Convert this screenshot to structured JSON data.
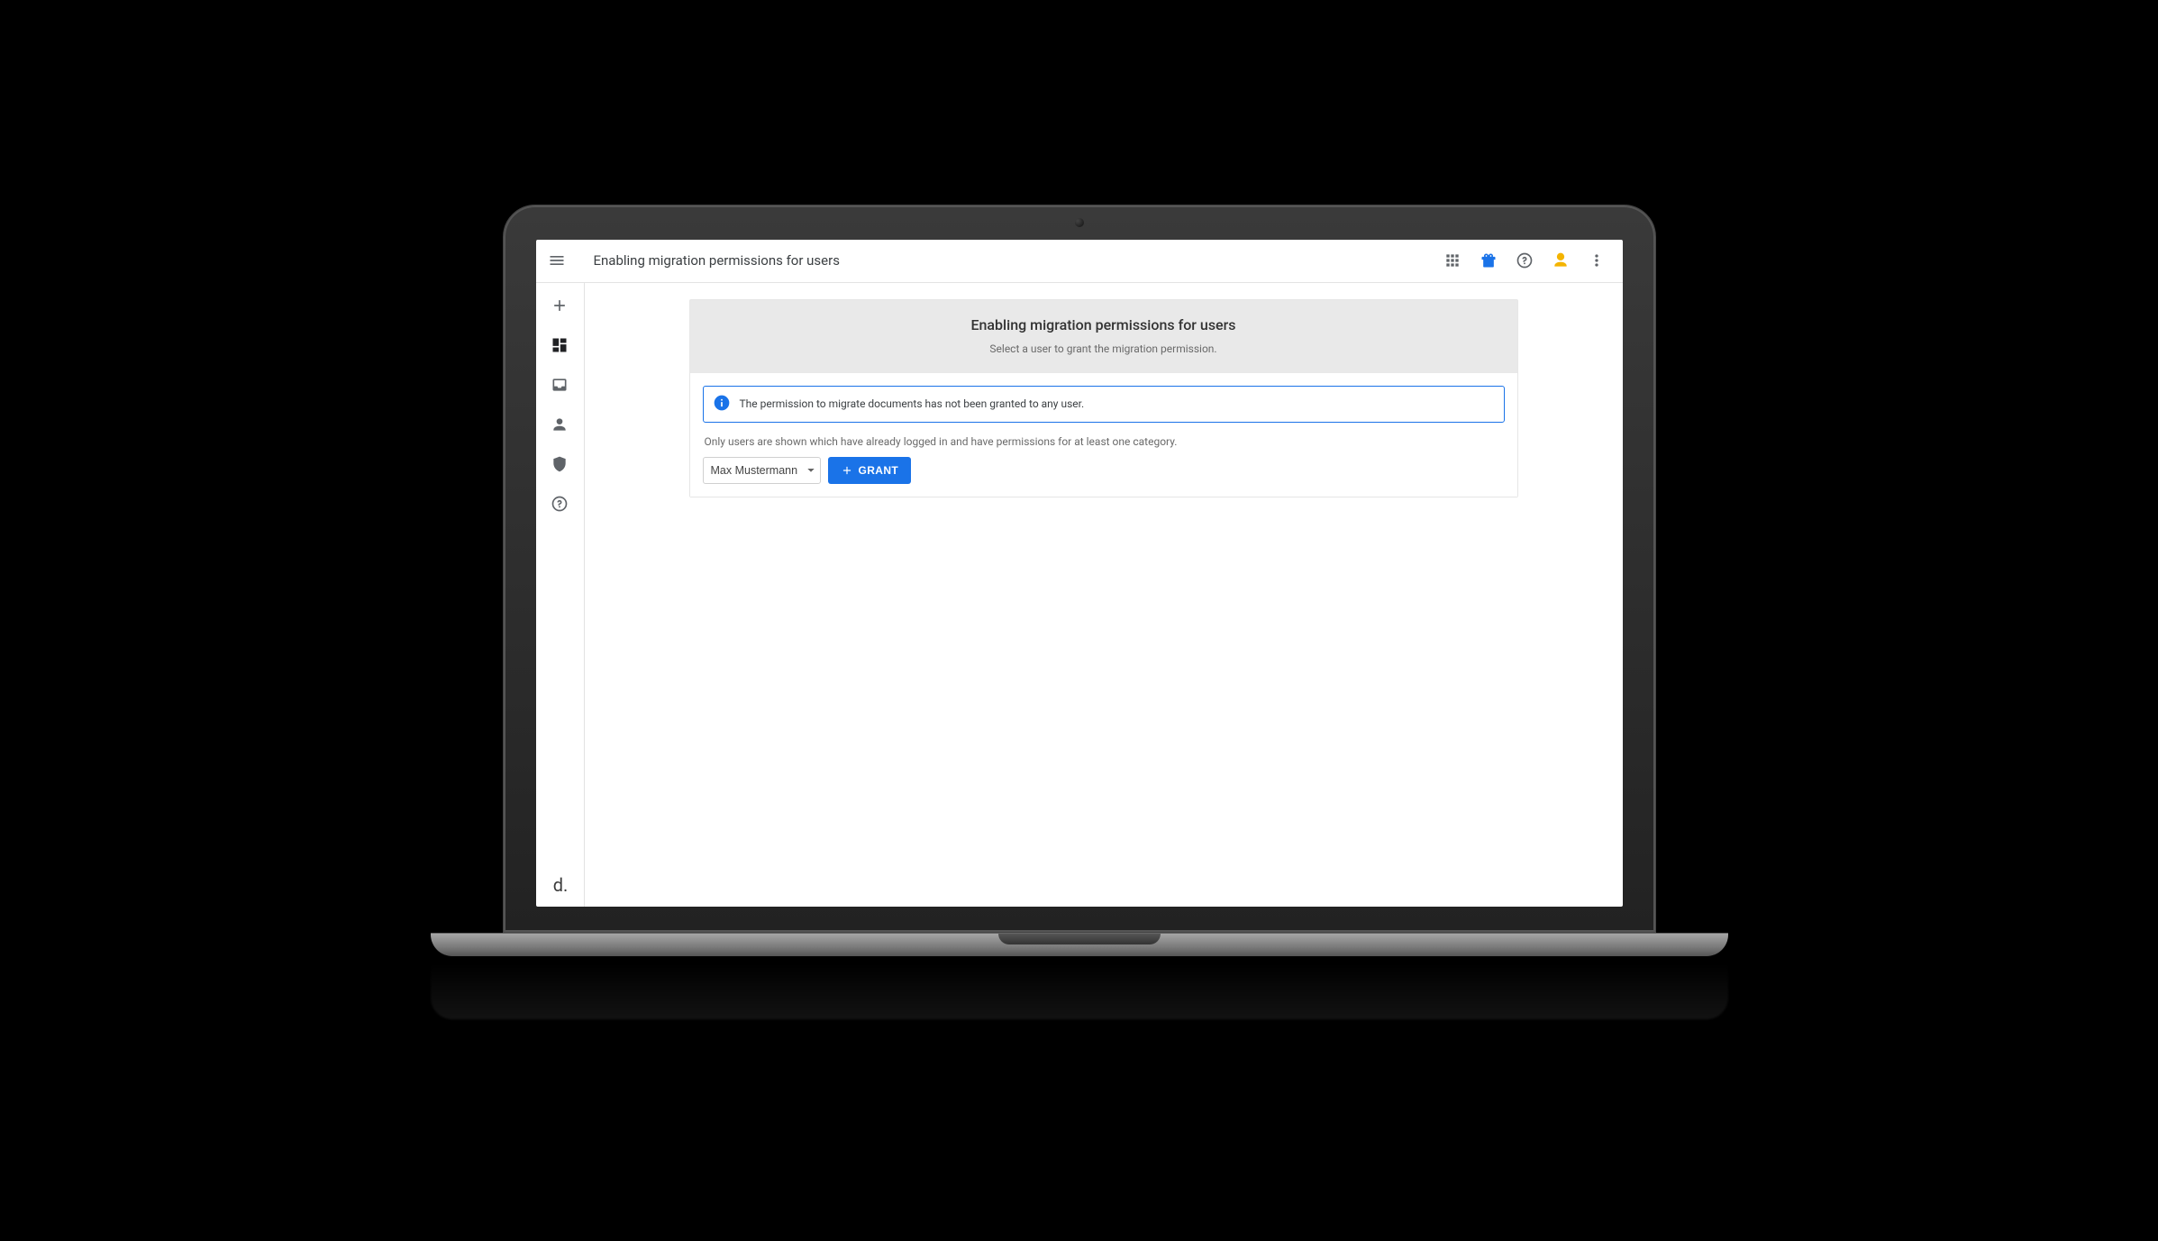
{
  "header": {
    "title": "Enabling migration permissions for users"
  },
  "card": {
    "heading": "Enabling migration permissions for users",
    "subheading": "Select a user to grant the migration permission.",
    "info_message": "The permission to migrate documents has not been granted to any user.",
    "note": "Only users are shown which have already logged in and have permissions for at least one category.",
    "selected_user": "Max Mustermann",
    "grant_label": "GRANT"
  },
  "brand": "d."
}
